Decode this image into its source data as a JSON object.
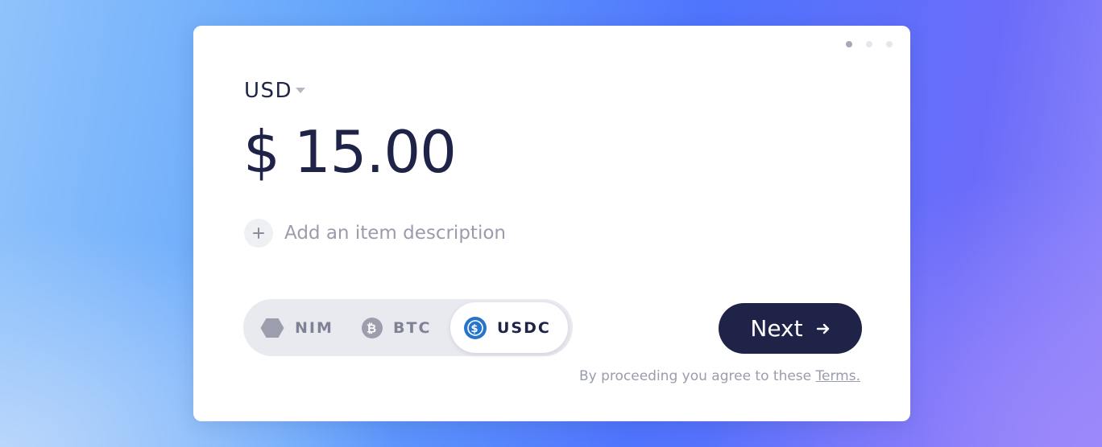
{
  "currency": {
    "code": "USD"
  },
  "amount": {
    "symbol": "$",
    "value": "15.00"
  },
  "description": {
    "placeholder": "Add an item description"
  },
  "coins": [
    {
      "label": "NIM",
      "icon": "nim-hexagon-icon"
    },
    {
      "label": "BTC",
      "icon": "bitcoin-icon"
    },
    {
      "label": "USDC",
      "icon": "usdc-icon",
      "selected": true
    }
  ],
  "next_button": {
    "label": "Next"
  },
  "terms": {
    "prefix": "By proceeding you agree to these",
    "link": "Terms."
  },
  "steps": {
    "total": 3,
    "current": 1
  },
  "colors": {
    "primary": "#1f2348",
    "muted": "#9a9cac",
    "usdc": "#2775ca"
  }
}
